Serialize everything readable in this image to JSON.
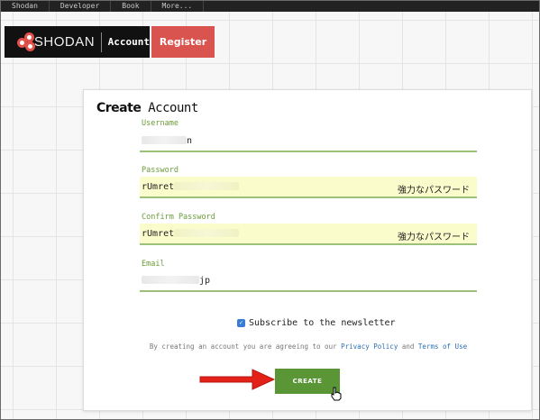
{
  "topnav": {
    "links": [
      "Shodan",
      "Developer",
      "Book",
      "More..."
    ]
  },
  "brand": {
    "name": "SHODAN",
    "section": "Account",
    "register_label": "Register"
  },
  "form": {
    "title_bold": "Create",
    "title_rest": " Account",
    "username": {
      "label": "Username",
      "value_suffix": "n"
    },
    "password": {
      "label": "Password",
      "value_prefix": "rUmret",
      "strength": "強力なパスワード"
    },
    "confirm_password": {
      "label": "Confirm Password",
      "value_prefix": "rUmret",
      "strength": "強力なパスワード"
    },
    "email": {
      "label": "Email",
      "value_suffix": "jp"
    },
    "subscribe_label": "Subscribe to the newsletter",
    "subscribe_checked": true,
    "terms_prefix": "By creating an account you are agreeing to our ",
    "privacy_link": "Privacy Policy",
    "terms_and": " and ",
    "terms_link": "Terms of Use",
    "create_label": "CREATE"
  },
  "colors": {
    "accent_green": "#5a9636",
    "label_green": "#6a9c3a",
    "brand_red": "#d9534f",
    "annotation_arrow": "#e32119"
  },
  "icons": {
    "logo": "shodan-logo-icon",
    "checkbox": "checkbox-checked-icon",
    "arrow": "red-arrow-annotation-icon",
    "cursor": "hand-pointer-cursor-icon"
  }
}
